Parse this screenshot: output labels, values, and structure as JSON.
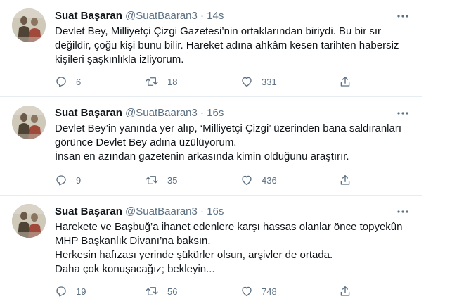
{
  "tweets": [
    {
      "author_name": "Suat Başaran",
      "author_handle": "@SuatBaaran3",
      "separator": "·",
      "time": "14s",
      "lines": [
        "Devlet Bey, Milliyetçi Çizgi Gazetesi’nin ortaklarından biriydi. Bu bir sır",
        "değildir, çoğu kişi bunu bilir. Hareket adına ahkâm kesen tarihten habersiz",
        "kişileri şaşkınlıkla izliyorum."
      ],
      "replies": "6",
      "retweets": "18",
      "likes": "331"
    },
    {
      "author_name": "Suat Başaran",
      "author_handle": "@SuatBaaran3",
      "separator": "·",
      "time": "16s",
      "lines": [
        "Devlet Bey’in yanında yer alıp, ‘Milliyetçi Çizgi’ üzerinden bana saldıranları",
        "görünce Devlet Bey adına üzülüyorum.",
        "İnsan en azından gazetenin arkasında kimin olduğunu araştırır."
      ],
      "replies": "9",
      "retweets": "35",
      "likes": "436"
    },
    {
      "author_name": "Suat Başaran",
      "author_handle": "@SuatBaaran3",
      "separator": "·",
      "time": "16s",
      "lines": [
        "Harekete ve Başbuğ’a ihanet edenlere karşı hassas olanlar önce topyekûn",
        "MHP Başkanlık Divanı’na baksın.",
        "Herkesin hafızası yerinde şükürler olsun, arşivler de ortada.",
        "Daha çok konuşacağız; bekleyin..."
      ],
      "replies": "19",
      "retweets": "56",
      "likes": "748"
    }
  ],
  "icons": {
    "reply": "reply-icon",
    "retweet": "retweet-icon",
    "like": "like-icon",
    "share": "share-icon",
    "more": "more-options-icon"
  },
  "colors": {
    "text_primary": "#0f1419",
    "text_secondary": "#5b7083",
    "divider": "#e6ecf0"
  }
}
